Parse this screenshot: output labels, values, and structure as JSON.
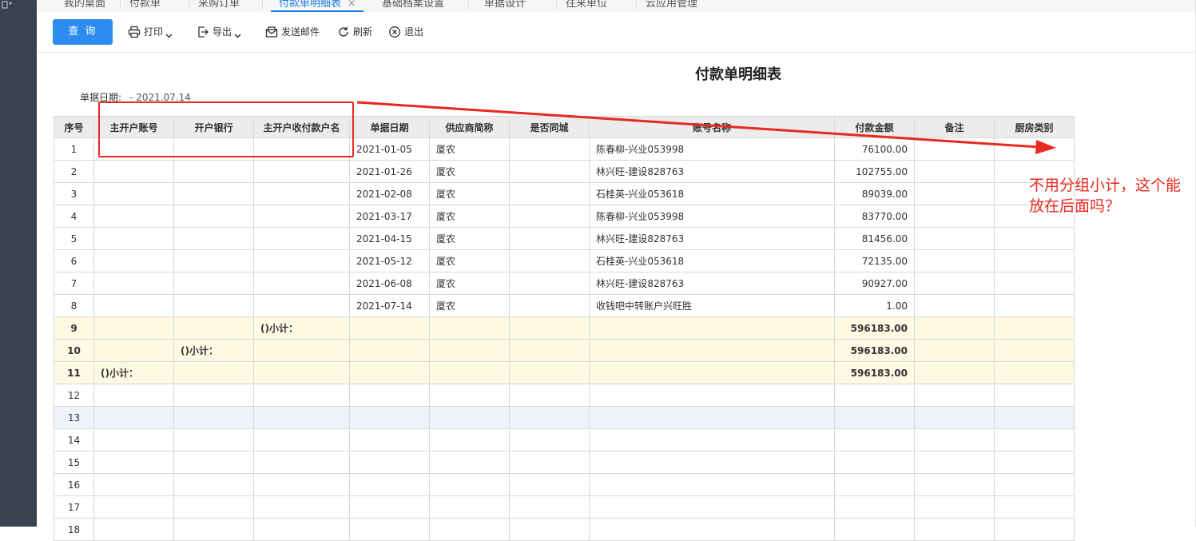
{
  "tabs": [
    {
      "label": "我的桌面",
      "active": false
    },
    {
      "label": "付款单",
      "active": false
    },
    {
      "label": "采购订单",
      "active": false
    },
    {
      "label": "付款单明细表",
      "active": true
    },
    {
      "label": "基础档案设置",
      "active": false
    },
    {
      "label": "单据设计",
      "active": false
    },
    {
      "label": "往来单位",
      "active": false
    },
    {
      "label": "云应用管理",
      "active": false
    }
  ],
  "toolbar": {
    "query": "查 询",
    "print": "打印",
    "export": "导出",
    "send_mail": "发送邮件",
    "refresh": "刷新",
    "exit": "退出"
  },
  "report": {
    "title": "付款单明细表",
    "date_label": "单据日期:",
    "date_value": "- 2021.07.14"
  },
  "table": {
    "headers": [
      "序号",
      "主开户账号",
      "开户银行",
      "主开户收付款户名",
      "单据日期",
      "供应商简称",
      "是否同城",
      "账号名称",
      "付款金额",
      "备注",
      "厨房类别"
    ],
    "rows": [
      {
        "no": "1",
        "c1": "",
        "c2": "",
        "c3": "",
        "date": "2021-01-05",
        "supplier": "厦农",
        "same_city": "",
        "account": "陈春柳-兴业053998",
        "amount": "76100.00",
        "note": "",
        "kitchen": ""
      },
      {
        "no": "2",
        "c1": "",
        "c2": "",
        "c3": "",
        "date": "2021-01-26",
        "supplier": "厦农",
        "same_city": "",
        "account": "林兴旺-建设828763",
        "amount": "102755.00",
        "note": "",
        "kitchen": ""
      },
      {
        "no": "3",
        "c1": "",
        "c2": "",
        "c3": "",
        "date": "2021-02-08",
        "supplier": "厦农",
        "same_city": "",
        "account": "石桂英-兴业053618",
        "amount": "89039.00",
        "note": "",
        "kitchen": ""
      },
      {
        "no": "4",
        "c1": "",
        "c2": "",
        "c3": "",
        "date": "2021-03-17",
        "supplier": "厦农",
        "same_city": "",
        "account": "陈春柳-兴业053998",
        "amount": "83770.00",
        "note": "",
        "kitchen": ""
      },
      {
        "no": "5",
        "c1": "",
        "c2": "",
        "c3": "",
        "date": "2021-04-15",
        "supplier": "厦农",
        "same_city": "",
        "account": "林兴旺-建设828763",
        "amount": "81456.00",
        "note": "",
        "kitchen": ""
      },
      {
        "no": "6",
        "c1": "",
        "c2": "",
        "c3": "",
        "date": "2021-05-12",
        "supplier": "厦农",
        "same_city": "",
        "account": "石桂英-兴业053618",
        "amount": "72135.00",
        "note": "",
        "kitchen": ""
      },
      {
        "no": "7",
        "c1": "",
        "c2": "",
        "c3": "",
        "date": "2021-06-08",
        "supplier": "厦农",
        "same_city": "",
        "account": "林兴旺-建设828763",
        "amount": "90927.00",
        "note": "",
        "kitchen": ""
      },
      {
        "no": "8",
        "c1": "",
        "c2": "",
        "c3": "",
        "date": "2021-07-14",
        "supplier": "厦农",
        "same_city": "",
        "account": "收钱吧中转账户兴旺胜",
        "amount": "1.00",
        "note": "",
        "kitchen": ""
      },
      {
        "no": "9",
        "c1": "",
        "c2": "",
        "c3": "()小计：",
        "date": "",
        "supplier": "",
        "same_city": "",
        "account": "",
        "amount": "596183.00",
        "note": "",
        "kitchen": "",
        "type": "subtotal"
      },
      {
        "no": "10",
        "c1": "",
        "c2": "()小计：",
        "c3": "",
        "date": "",
        "supplier": "",
        "same_city": "",
        "account": "",
        "amount": "596183.00",
        "note": "",
        "kitchen": "",
        "type": "subtotal"
      },
      {
        "no": "11",
        "c1": "()小计：",
        "c2": "",
        "c3": "",
        "date": "",
        "supplier": "",
        "same_city": "",
        "account": "",
        "amount": "596183.00",
        "note": "",
        "kitchen": "",
        "type": "subtotal"
      },
      {
        "no": "12",
        "c1": "",
        "c2": "",
        "c3": "",
        "date": "",
        "supplier": "",
        "same_city": "",
        "account": "",
        "amount": "",
        "note": "",
        "kitchen": ""
      },
      {
        "no": "13",
        "c1": "",
        "c2": "",
        "c3": "",
        "date": "",
        "supplier": "",
        "same_city": "",
        "account": "",
        "amount": "",
        "note": "",
        "kitchen": "",
        "type": "highlight"
      },
      {
        "no": "14",
        "c1": "",
        "c2": "",
        "c3": "",
        "date": "",
        "supplier": "",
        "same_city": "",
        "account": "",
        "amount": "",
        "note": "",
        "kitchen": ""
      },
      {
        "no": "15",
        "c1": "",
        "c2": "",
        "c3": "",
        "date": "",
        "supplier": "",
        "same_city": "",
        "account": "",
        "amount": "",
        "note": "",
        "kitchen": ""
      },
      {
        "no": "16",
        "c1": "",
        "c2": "",
        "c3": "",
        "date": "",
        "supplier": "",
        "same_city": "",
        "account": "",
        "amount": "",
        "note": "",
        "kitchen": ""
      },
      {
        "no": "17",
        "c1": "",
        "c2": "",
        "c3": "",
        "date": "",
        "supplier": "",
        "same_city": "",
        "account": "",
        "amount": "",
        "note": "",
        "kitchen": ""
      },
      {
        "no": "18",
        "c1": "",
        "c2": "",
        "c3": "",
        "date": "",
        "supplier": "",
        "same_city": "",
        "account": "",
        "amount": "",
        "note": "",
        "kitchen": ""
      }
    ]
  },
  "annotation": {
    "text": "不用分组小计，这个能放在后面吗？",
    "color": "#e8291f"
  },
  "colors": {
    "accent": "#2d8cf0",
    "subtotal_bg": "#fdf9e3",
    "header_bg": "#ececec"
  }
}
